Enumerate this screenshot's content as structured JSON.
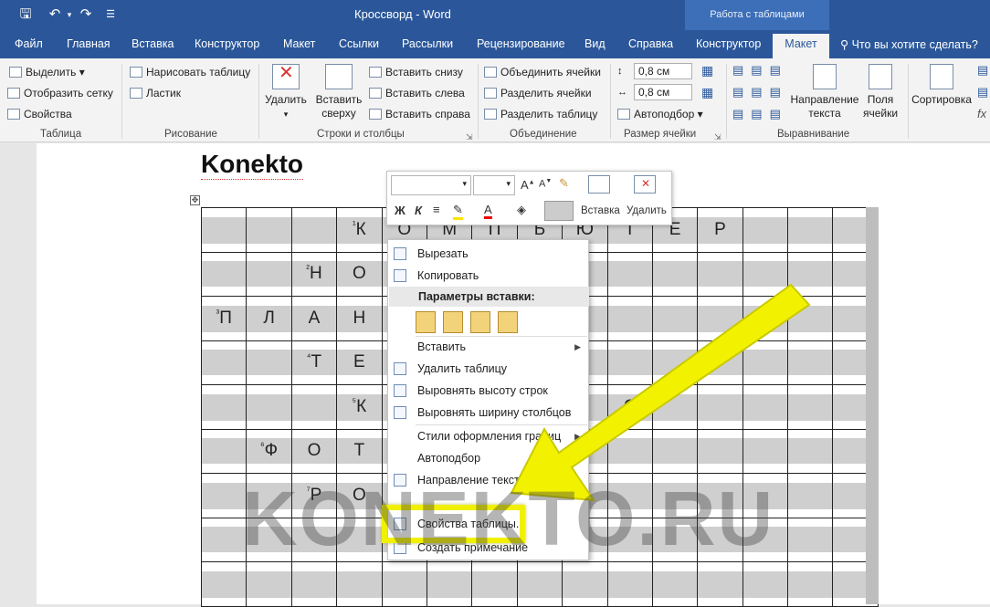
{
  "window": {
    "title": "Кроссворд  -  Word",
    "tool_tab_header": "Работа с таблицами"
  },
  "tabs": [
    "Файл",
    "Главная",
    "Вставка",
    "Конструктор",
    "Макет",
    "Ссылки",
    "Рассылки",
    "Рецензирование",
    "Вид",
    "Справка",
    "Конструктор",
    "Макет"
  ],
  "tell_me": "Что вы хотите сделать?",
  "ribbon": {
    "table": {
      "select": "Выделить",
      "grid": "Отобразить сетку",
      "props": "Свойства",
      "group": "Таблица"
    },
    "draw": {
      "draw_table": "Нарисовать таблицу",
      "eraser": "Ластик",
      "group": "Рисование"
    },
    "rows": {
      "delete": "Удалить",
      "insert_above_1": "Вставить",
      "insert_above_2": "сверху",
      "below": "Вставить снизу",
      "left": "Вставить слева",
      "right": "Вставить справа",
      "group": "Строки и столбцы"
    },
    "merge": {
      "merge": "Объединить ячейки",
      "split": "Разделить ячейки",
      "split_table": "Разделить таблицу",
      "group": "Объединение"
    },
    "size": {
      "height": "0,8 см",
      "width": "0,8 см",
      "autofit": "Автоподбор",
      "group": "Размер ячейки"
    },
    "align": {
      "direction_1": "Направление",
      "direction_2": "текста",
      "margins_1": "Поля",
      "margins_2": "ячейки",
      "group": "Выравнивание"
    },
    "data": {
      "sort": "Сортировка"
    }
  },
  "document": {
    "heading": "Konekto",
    "grid": [
      [
        "",
        "",
        "",
        "¹|К",
        "О",
        "М",
        "П",
        "Ь",
        "Ю",
        "Т",
        "Е",
        "Р",
        "",
        "",
        ""
      ],
      [
        "",
        "",
        "²|Н",
        "О",
        "",
        "",
        "",
        "",
        "",
        "",
        "",
        "",
        "",
        "",
        ""
      ],
      [
        "³|П",
        "Л",
        "А",
        "Н",
        "",
        "",
        "",
        "",
        "",
        "",
        "",
        "",
        "",
        "",
        ""
      ],
      [
        "",
        "",
        "⁴|Т",
        "Е",
        "",
        "",
        "",
        "",
        "",
        "",
        "",
        "",
        "",
        "",
        ""
      ],
      [
        "",
        "",
        "",
        "⁵|К",
        "",
        "",
        "",
        "",
        "",
        "С",
        "",
        "",
        "",
        "",
        ""
      ],
      [
        "",
        "⁶|Ф",
        "О",
        "Т",
        "",
        "",
        "",
        "",
        "",
        "",
        "",
        "",
        "",
        "",
        ""
      ],
      [
        "",
        "",
        "⁷|Р",
        "О",
        "",
        "",
        "",
        "",
        "",
        "",
        "",
        "",
        "",
        "",
        ""
      ],
      [
        "",
        "",
        "",
        "",
        "",
        "",
        "",
        "",
        "",
        "",
        "",
        "",
        "",
        "",
        ""
      ],
      [
        "",
        "",
        "",
        "",
        "",
        "",
        "",
        "",
        "",
        "",
        "",
        "",
        "",
        "",
        ""
      ]
    ]
  },
  "mini_toolbar": {
    "bold": "Ж",
    "italic": "К",
    "insert": "Вставка",
    "delete": "Удалить"
  },
  "context_menu": {
    "cut": "Вырезать",
    "copy": "Копировать",
    "paste_header": "Параметры вставки:",
    "insert": "Вставить",
    "delete_table": "Удалить таблицу",
    "distribute_rows": "Выровнять высоту строк",
    "distribute_cols": "Выровнять ширину столбцов",
    "border_styles": "Стили оформления границ",
    "autofit": "Автоподбор",
    "text_direction": "Направление текста...",
    "table_props": "Свойства таблицы...",
    "new_comment": "Создать примечание"
  },
  "watermark": "KONEKTO.RU",
  "colors": {
    "accent": "#2b579a",
    "highlight": "#f0f000"
  }
}
